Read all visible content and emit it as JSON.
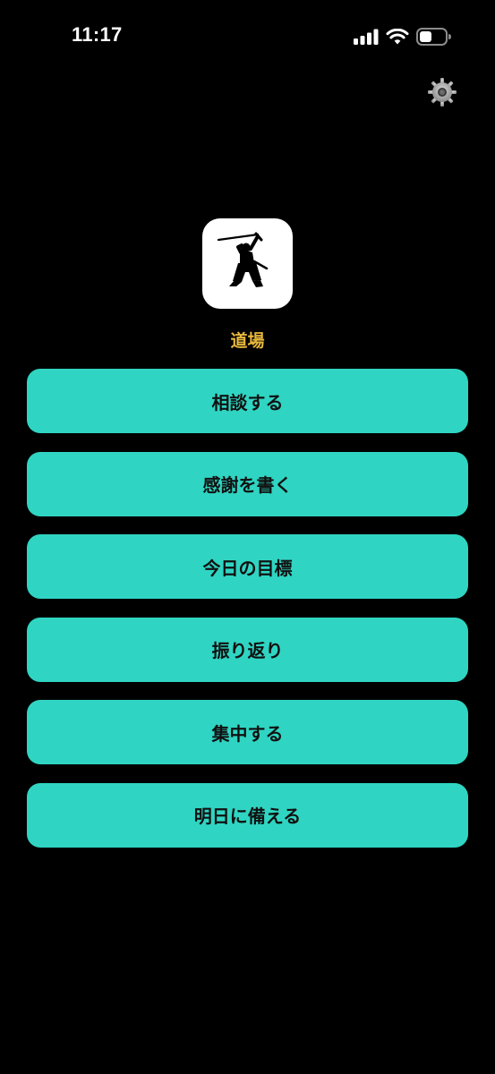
{
  "status_bar": {
    "time": "11:17",
    "icons": [
      "signal-icon",
      "wifi-icon",
      "battery-icon"
    ]
  },
  "header": {
    "settings_icon": "gear-icon"
  },
  "app": {
    "logo_icon": "samurai-logo",
    "title": "道場"
  },
  "menu": {
    "items": [
      {
        "label": "相談する"
      },
      {
        "label": "感謝を書く"
      },
      {
        "label": "今日の目標"
      },
      {
        "label": "振り返り"
      },
      {
        "label": "集中する"
      },
      {
        "label": "明日に備える"
      }
    ]
  },
  "colors": {
    "background": "#000000",
    "accent_button": "#2fd5c2",
    "title_gold": "#e7b83d",
    "button_text": "#111111"
  }
}
